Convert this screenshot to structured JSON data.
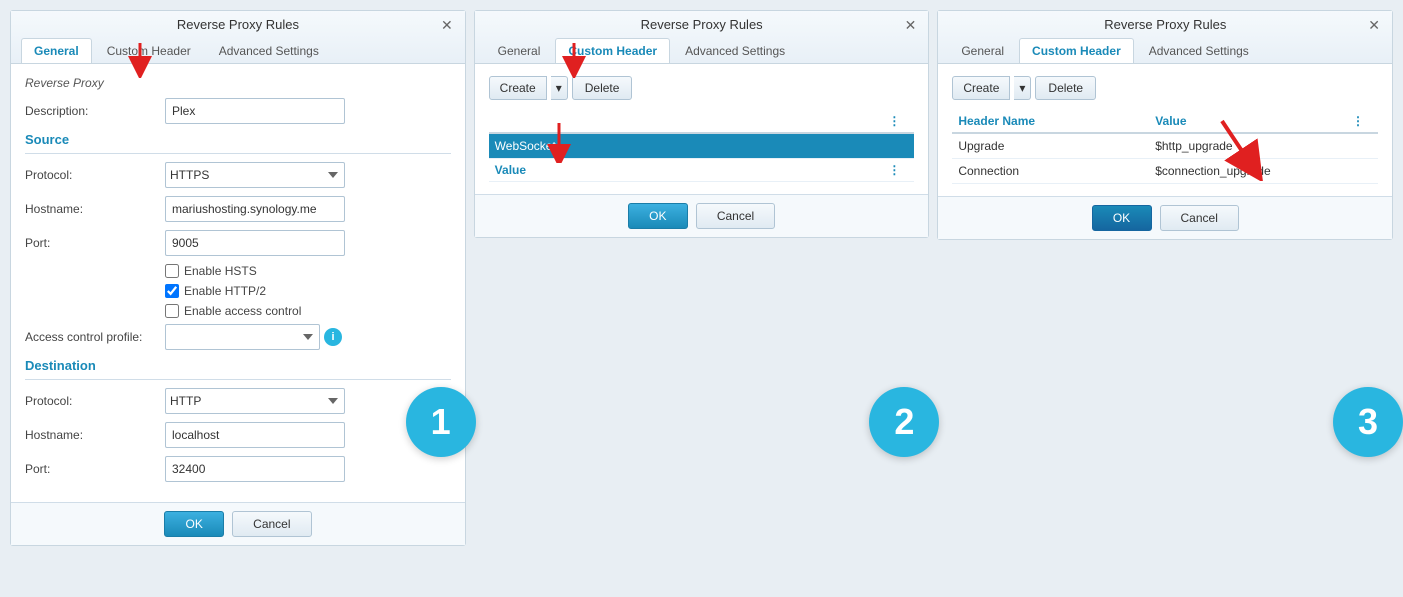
{
  "panels": [
    {
      "id": "panel1",
      "title": "Reverse Proxy Rules",
      "tabs": [
        "General",
        "Custom Header",
        "Advanced Settings"
      ],
      "activeTab": "General",
      "step": "1",
      "form": {
        "reverseProxy": "Reverse Proxy",
        "descriptionLabel": "Description:",
        "descriptionValue": "Plex",
        "sourceLabel": "Source",
        "protocolLabel": "Protocol:",
        "protocolValue": "HTTPS",
        "protocolOptions": [
          "HTTP",
          "HTTPS"
        ],
        "hostnameLabel": "Hostname:",
        "hostnameValue": "mariushosting.synology.me",
        "portLabel": "Port:",
        "portValue": "9005",
        "enableHSTS": "Enable HSTS",
        "enableHTTP2": "Enable HTTP/2",
        "enableHTTP2Checked": true,
        "enableAccessControl": "Enable access control",
        "accessControlLabel": "Access control profile:",
        "destinationLabel": "Destination",
        "destProtocolLabel": "Protocol:",
        "destProtocolValue": "HTTP",
        "destProtocolOptions": [
          "HTTP",
          "HTTPS"
        ],
        "destHostnameLabel": "Hostname:",
        "destHostnameValue": "localhost",
        "destPortLabel": "Port:",
        "destPortValue": "32400"
      },
      "footer": {
        "okLabel": "OK",
        "cancelLabel": "Cancel"
      }
    },
    {
      "id": "panel2",
      "title": "Reverse Proxy Rules",
      "tabs": [
        "General",
        "Custom Header",
        "Advanced Settings"
      ],
      "activeTab": "Custom Header",
      "step": "2",
      "toolbar": {
        "createLabel": "Create",
        "deleteLabel": "Delete"
      },
      "tableHeaders": [
        "WebSocket",
        "Value"
      ],
      "tableRows": [],
      "footer": {
        "okLabel": "OK",
        "cancelLabel": "Cancel"
      }
    },
    {
      "id": "panel3",
      "title": "Reverse Proxy Rules",
      "tabs": [
        "General",
        "Custom Header",
        "Advanced Settings"
      ],
      "activeTab": "Custom Header",
      "step": "3",
      "toolbar": {
        "createLabel": "Create",
        "deleteLabel": "Delete"
      },
      "tableHeaders": [
        "Header Name",
        "Value"
      ],
      "tableRows": [
        {
          "name": "Upgrade",
          "value": "$http_upgrade"
        },
        {
          "name": "Connection",
          "value": "$connection_upgrade"
        }
      ],
      "footer": {
        "okLabel": "OK",
        "cancelLabel": "Cancel"
      }
    }
  ]
}
